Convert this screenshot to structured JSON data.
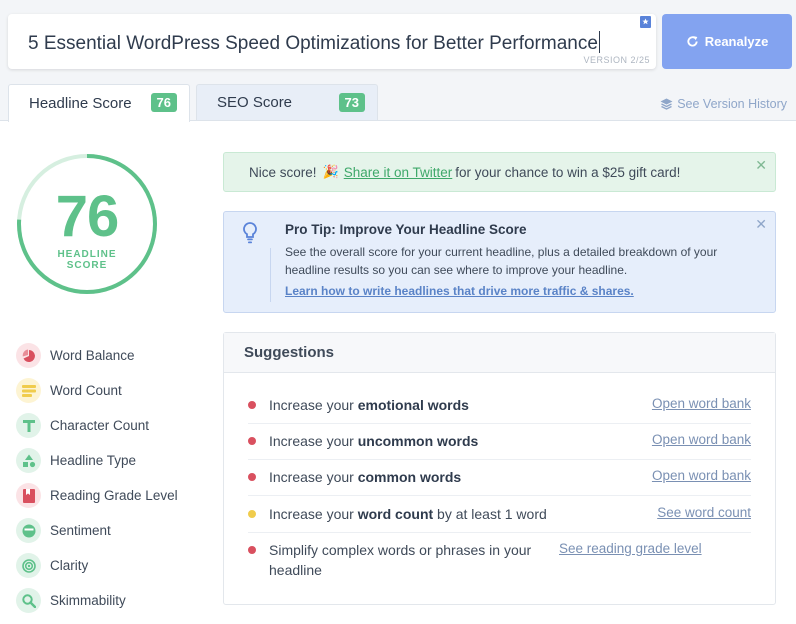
{
  "headline": {
    "text": "5 Essential WordPress Speed Optimizations for Better Performance",
    "version": "VERSION 2/25",
    "reanalyze_label": "Reanalyze"
  },
  "tabs": [
    {
      "label": "Headline Score",
      "score": "76"
    },
    {
      "label": "SEO Score",
      "score": "73"
    }
  ],
  "version_history": "See Version History",
  "score": {
    "value": "76",
    "label_line1": "HEADLINE",
    "label_line2": "SCORE",
    "fraction": 0.76,
    "color": "#5ec18a"
  },
  "metrics": [
    {
      "label": "Word Balance",
      "icon": "pie-chart-icon",
      "tone": "red"
    },
    {
      "label": "Word Count",
      "icon": "lines-icon",
      "tone": "yellow"
    },
    {
      "label": "Character Count",
      "icon": "letter-t-icon",
      "tone": "green"
    },
    {
      "label": "Headline Type",
      "icon": "shapes-icon",
      "tone": "green"
    },
    {
      "label": "Reading Grade Level",
      "icon": "book-icon",
      "tone": "red"
    },
    {
      "label": "Sentiment",
      "icon": "smile-icon",
      "tone": "green"
    },
    {
      "label": "Clarity",
      "icon": "target-icon",
      "tone": "green"
    },
    {
      "label": "Skimmability",
      "icon": "magnifier-icon",
      "tone": "green"
    }
  ],
  "success_alert": {
    "before": "Nice score!",
    "link": "Share it on Twitter",
    "after": "for your chance to win a $25 gift card!"
  },
  "tip": {
    "title": "Pro Tip: Improve Your Headline Score",
    "body": "See the overall score for your current headline, plus a detailed breakdown of your headline results so you can see where to improve your headline.",
    "link": "Learn how to write headlines that drive more traffic & shares."
  },
  "suggestions": {
    "title": "Suggestions",
    "items": [
      {
        "pre": "Increase your ",
        "bold": "emotional words",
        "post": "",
        "link": "Open word bank",
        "tone": "red"
      },
      {
        "pre": "Increase your ",
        "bold": "uncommon words",
        "post": "",
        "link": "Open word bank",
        "tone": "red"
      },
      {
        "pre": "Increase your ",
        "bold": "common words",
        "post": "",
        "link": "Open word bank",
        "tone": "red"
      },
      {
        "pre": "Increase your ",
        "bold": "word count",
        "post": " by at least 1 word",
        "link": "See word count",
        "tone": "yellow"
      },
      {
        "pre": "Simplify complex words or phrases in your headline",
        "bold": "",
        "post": "",
        "link": "See reading grade level",
        "tone": "red"
      }
    ]
  },
  "colors": {
    "accent": "#83a3f0",
    "good": "#5ec18a",
    "bad": "#d9505f",
    "warn": "#f0cc4c"
  }
}
